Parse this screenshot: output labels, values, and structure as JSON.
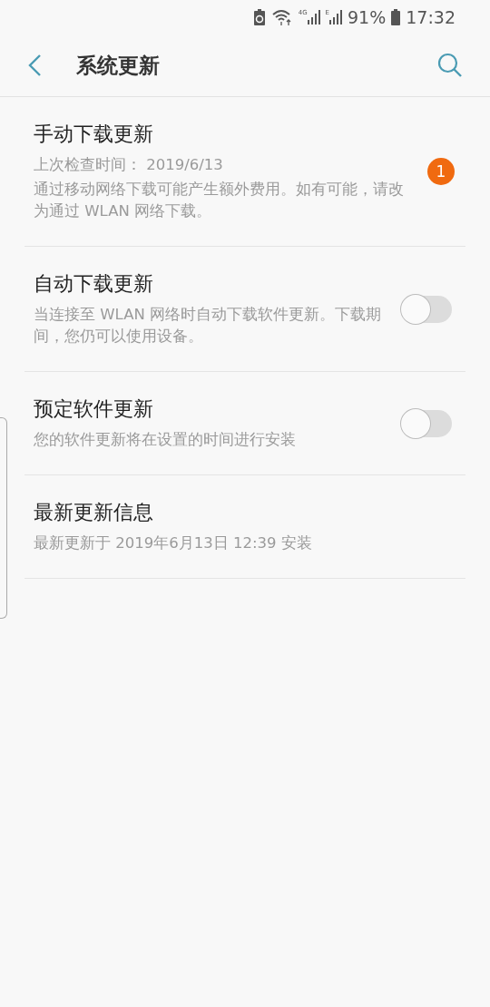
{
  "status_bar": {
    "networks": [
      {
        "label": "4G"
      },
      {
        "label": "E"
      }
    ],
    "battery": "91%",
    "time": "17:32"
  },
  "header": {
    "title": "系统更新"
  },
  "items": [
    {
      "kind": "badge",
      "title": "手动下载更新",
      "lines": [
        "上次检查时间： 2019/6/13",
        "通过移动网络下载可能产生额外费用。如有可能，请改为通过 WLAN 网络下载。"
      ],
      "badge": "1"
    },
    {
      "kind": "switch",
      "title": "自动下载更新",
      "lines": [
        "当连接至 WLAN 网络时自动下载软件更新。下载期间，您仍可以使用设备。"
      ],
      "on": false
    },
    {
      "kind": "switch",
      "title": "预定软件更新",
      "lines": [
        "您的软件更新将在设置的时间进行安装"
      ],
      "on": false
    },
    {
      "kind": "plain",
      "title": "最新更新信息",
      "lines": [
        "最新更新于 2019年6月13日 12:39 安装"
      ]
    }
  ]
}
